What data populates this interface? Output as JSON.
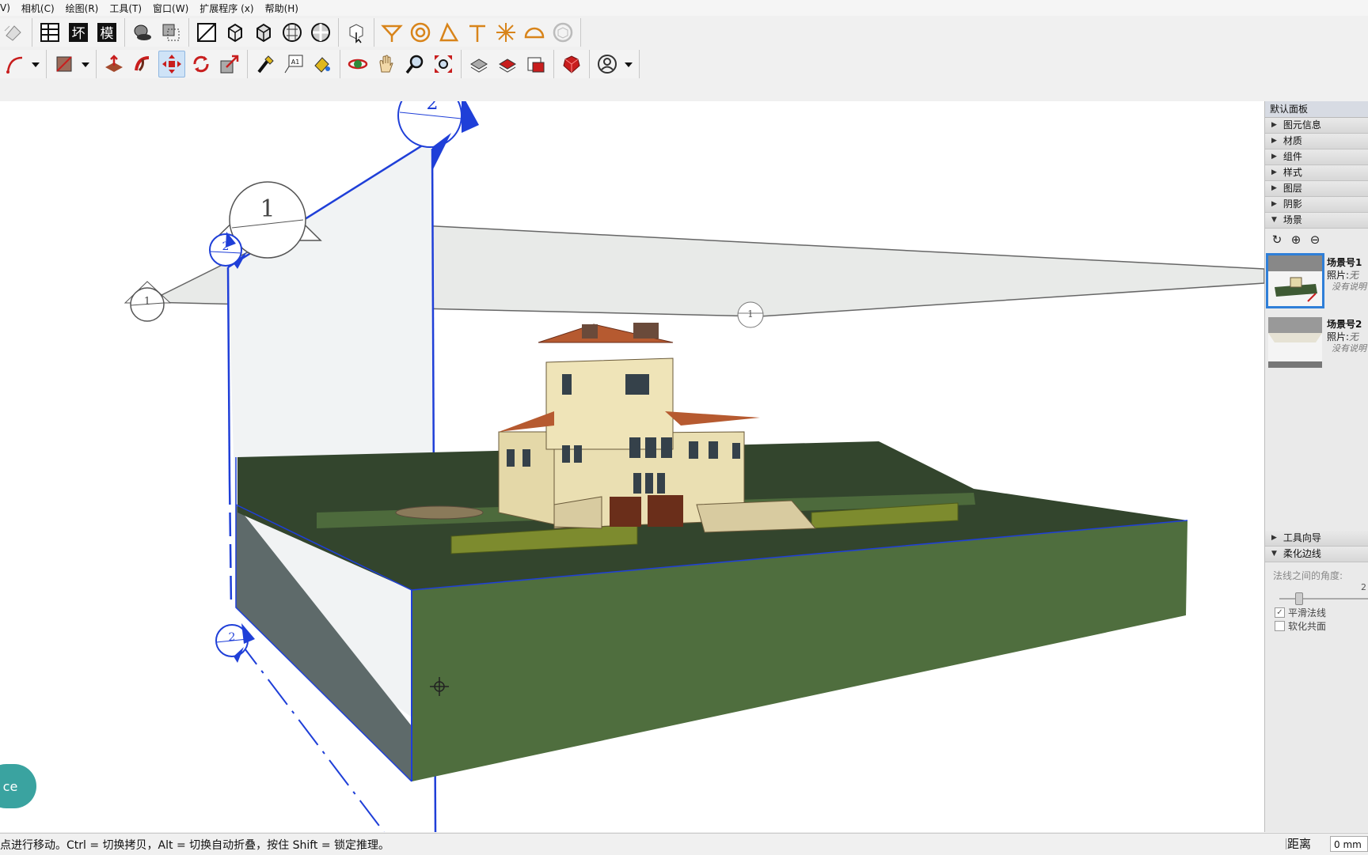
{
  "menu": [
    "V)",
    "相机(C)",
    "绘图(R)",
    "工具(T)",
    "窗口(W)",
    "扩展程序 (x)",
    "帮助(H)"
  ],
  "toolbar": {
    "row1_text_buttons": [
      "坏",
      "模"
    ],
    "icons_row1": [
      "eraser-icon",
      "layer-table-icon",
      "badge-huai-icon",
      "badge-mo-icon",
      "shadow-icon",
      "section-icon",
      "iso-view-icon",
      "front-view-icon",
      "right-view-icon",
      "back-view-icon",
      "left-view-icon",
      "select-icon",
      "walk-icon",
      "look-around-icon",
      "position-camera-icon",
      "zoom-window-icon",
      "sun-icon",
      "ruby-icon",
      "component-icon"
    ],
    "icons_row2": [
      "arc-icon",
      "caret-icon",
      "rectangle-icon",
      "caret-icon",
      "push-pull-icon",
      "follow-me-icon",
      "move-icon",
      "rotate-icon",
      "scale-icon",
      "tape-icon",
      "text-icon",
      "paint-icon",
      "orbit-icon",
      "pan-icon",
      "zoom-icon",
      "zoom-extents-icon",
      "warehouse-icon",
      "extension-warehouse-icon",
      "layout-icon",
      "ruby-console-icon",
      "user-icon",
      "caret-icon"
    ]
  },
  "viewport": {
    "section_labels": [
      "2",
      "1",
      "2",
      "1",
      "1",
      "2"
    ],
    "overlay_button": "ce"
  },
  "panel": {
    "title": "默认面板",
    "sections": [
      {
        "label": "图元信息",
        "expanded": false
      },
      {
        "label": "材质",
        "expanded": false
      },
      {
        "label": "组件",
        "expanded": false
      },
      {
        "label": "样式",
        "expanded": false
      },
      {
        "label": "图层",
        "expanded": false
      },
      {
        "label": "阴影",
        "expanded": false
      },
      {
        "label": "场景",
        "expanded": true
      }
    ],
    "scene_tools": [
      "↻",
      "⊕",
      "⊖"
    ],
    "scenes": [
      {
        "name": "场景号1",
        "photo_label": "照片:",
        "photo_value": "无",
        "desc": "没有说明",
        "selected": true
      },
      {
        "name": "场景号2",
        "photo_label": "照片:",
        "photo_value": "无",
        "desc": "没有说明",
        "selected": false
      }
    ],
    "lower_sections": [
      {
        "label": "工具向导",
        "expanded": false
      },
      {
        "label": "柔化边线",
        "expanded": true
      }
    ],
    "soft_edges": {
      "angle_label": "法线之间的角度:",
      "angle_value": "2",
      "smooth_normals": "平滑法线",
      "smooth_checked": true,
      "soften_coplanar": "软化共面",
      "coplanar_checked": false
    }
  },
  "status": {
    "message": "点进行移动。Ctrl = 切换拷贝，Alt = 切换自动折叠，按住 Shift = 锁定推理。",
    "measure_label": "距离",
    "measure_value": "0 mm"
  },
  "colors": {
    "accent": "#2f7fd8",
    "section_blue": "#1f3fd8",
    "grass_dark": "#3a4f34",
    "grass_side": "#4f6e3e",
    "teal": "#3aa3a0"
  }
}
